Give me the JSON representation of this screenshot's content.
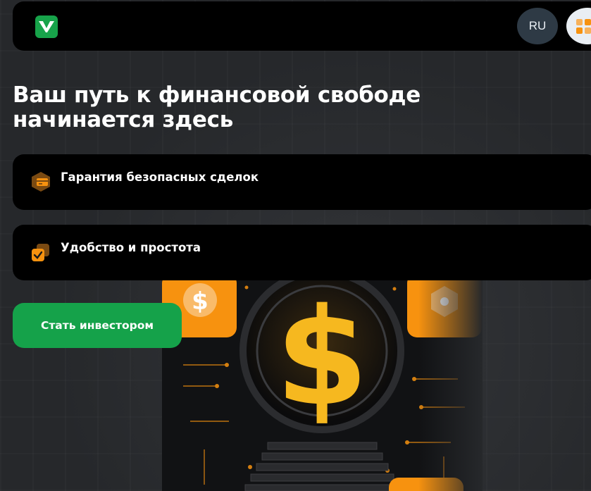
{
  "header": {
    "logo_icon": "brand-logo-icon",
    "lang_label": "RU",
    "menu_icon": "grid-menu-icon"
  },
  "hero": {
    "headline": "Ваш путь к финансовой свободе начинается здесь"
  },
  "features": [
    {
      "label": "Гарантия безопасных сделок",
      "icon": "wallet-card-icon"
    },
    {
      "label": "Удобство и простота",
      "icon": "checkbox-icon"
    }
  ],
  "cta": {
    "label": "Стать инвестором"
  },
  "colors": {
    "accent_green": "#15a24a",
    "accent_orange": "#f7920f",
    "gold": "#f6b81f",
    "background": "#26282b"
  }
}
